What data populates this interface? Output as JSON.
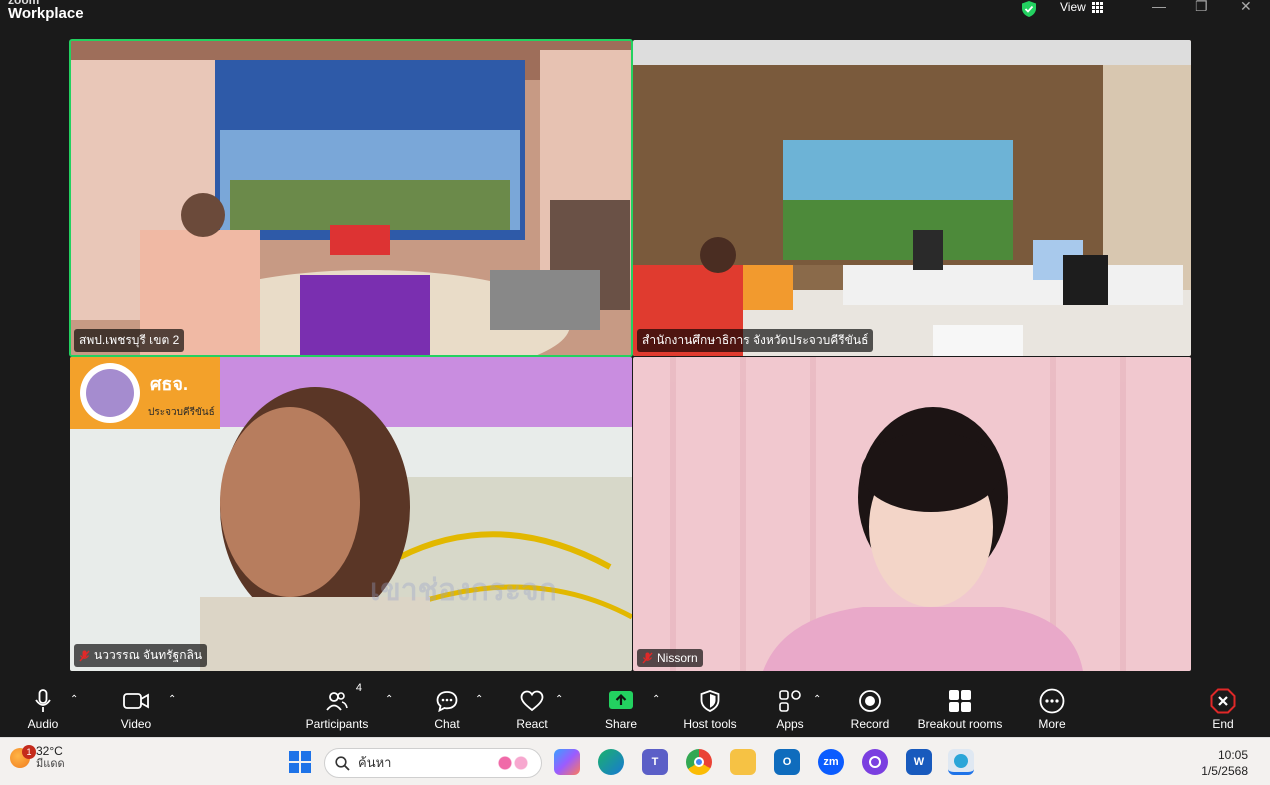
{
  "window": {
    "app_small": "zoom",
    "app_name": "Workplace",
    "view_label": "View",
    "minimize": "—",
    "restore": "❐",
    "close": "✕"
  },
  "colors": {
    "active_speaker": "#23d160",
    "share_green": "#23d160",
    "end_red": "#e02828",
    "mute_red": "#e02828"
  },
  "tiles": [
    {
      "name": "สพป.เพชรบุรี เขต 2",
      "muted": false,
      "active": true
    },
    {
      "name": "สำนักงานศึกษาธิการ จังหวัดประจวบคีรีขันธ์",
      "muted": false,
      "active": false
    },
    {
      "name": "นววรรณ จันทรัฐกลิน",
      "muted": true,
      "active": false
    },
    {
      "name": "Nissorn",
      "muted": true,
      "active": false
    }
  ],
  "tile_overlay": {
    "badge_text": "ศธจ.",
    "badge_sub": "ประจวบคีรีขันธ์",
    "bg_text": "เขาช่องกระจก"
  },
  "controls": {
    "audio": {
      "label": "Audio",
      "icon": "microphone-icon"
    },
    "video": {
      "label": "Video",
      "icon": "camera-icon"
    },
    "participants": {
      "label": "Participants",
      "count": "4",
      "icon": "participants-icon"
    },
    "chat": {
      "label": "Chat",
      "icon": "chat-icon"
    },
    "react": {
      "label": "React",
      "icon": "heart-icon"
    },
    "share": {
      "label": "Share",
      "icon": "share-icon"
    },
    "host_tools": {
      "label": "Host tools",
      "icon": "shield-icon"
    },
    "apps": {
      "label": "Apps",
      "icon": "apps-icon"
    },
    "record": {
      "label": "Record",
      "icon": "record-icon"
    },
    "breakout": {
      "label": "Breakout rooms",
      "icon": "breakout-icon"
    },
    "more": {
      "label": "More",
      "icon": "more-icon"
    },
    "end": {
      "label": "End",
      "icon": "end-icon"
    }
  },
  "taskbar": {
    "weather_temp": "32°C",
    "weather_desc": "มีแดด",
    "weather_badge": "1",
    "search_placeholder": "ค้นหา",
    "time": "10:05",
    "date": "1/5/2568",
    "zoom_app": "zm"
  }
}
